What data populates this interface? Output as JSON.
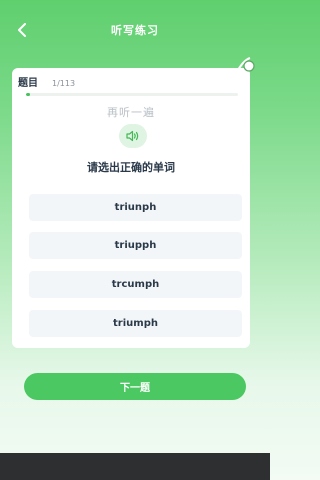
{
  "header": {
    "title": "听写练习",
    "back_icon": "chevron-left-icon"
  },
  "question": {
    "label": "题目",
    "counter": "1/113",
    "progress_fraction": 0.009,
    "replay_text": "再听一遍",
    "speaker_icon": "speaker-icon",
    "prompt": "请选出正确的单词"
  },
  "options": [
    {
      "text": "triunph"
    },
    {
      "text": "triupph"
    },
    {
      "text": "trcumph"
    },
    {
      "text": "triumph"
    }
  ],
  "next_button": {
    "label": "下一题"
  },
  "colors": {
    "brand_green": "#4cc862",
    "header_green": "#5fcf6e",
    "text_dark": "#2b3a4a"
  }
}
